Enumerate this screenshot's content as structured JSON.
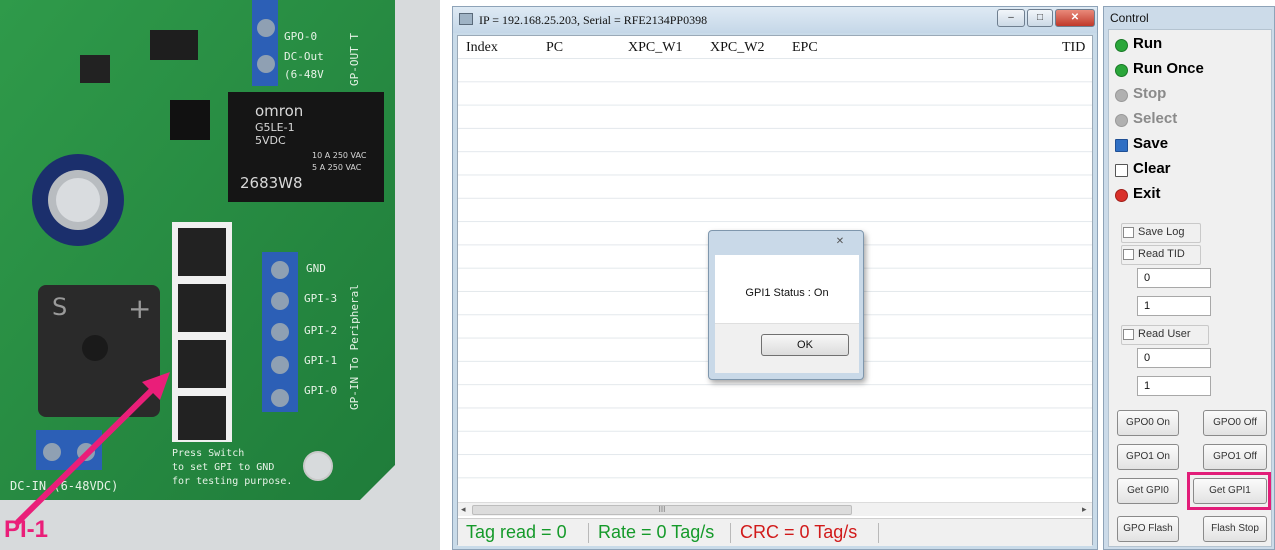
{
  "photo": {
    "board_relay_brand": "omron",
    "board_relay_model": "G5LE-1",
    "board_relay_voltage": "5VDC",
    "board_relay_code": "2683W8",
    "board_relay_rating1": "10 A 250 VAC",
    "board_relay_rating2": "5 A 250 VAC",
    "silk_gpo0": "GPO-0",
    "silk_dcout": "DC-Out",
    "silk_range_out": "(6-48V",
    "silk_gpout": "GP-OUT T",
    "silk_gnd": "GND",
    "silk_gpi3": "GPI-3",
    "silk_gpi2": "GPI-2",
    "silk_gpi1": "GPI-1",
    "silk_gpi0": "GPI-0",
    "silk_gpin": "GP-IN To Peripheral",
    "silk_press_line1": "Press Switch",
    "silk_press_line2": "to set GPI to GND",
    "silk_press_line3": "for testing purpose.",
    "silk_dcin": "DC-IN (6-48VDC)",
    "silk_s": "S",
    "silk_plus": "+",
    "callout_label": "PI-1"
  },
  "tag_window": {
    "title": "IP = 192.168.25.203, Serial = RFE2134PP0398",
    "minimize_glyph": "–",
    "maximize_glyph": "□",
    "close_glyph": "✕",
    "columns": [
      "Index",
      "PC",
      "XPC_W1",
      "XPC_W2",
      "EPC",
      "TID"
    ],
    "scroll_left_glyph": "◂",
    "scroll_right_glyph": "▸",
    "scroll_thumb_glyph": "III",
    "status": {
      "tag_read": "Tag read = 0",
      "rate": "Rate = 0 Tag/s",
      "crc": "CRC = 0 Tag/s"
    },
    "dialog": {
      "close_glyph": "✕",
      "message": "GPI1 Status : On",
      "ok_label": "OK"
    }
  },
  "control": {
    "title": "Control",
    "menu": [
      {
        "label": "Run",
        "color": "#1a1a1a",
        "icon_color": "#2aa63a"
      },
      {
        "label": "Run Once",
        "color": "#1a1a1a",
        "icon_color": "#2aa63a"
      },
      {
        "label": "Stop",
        "color": "#8a8a8a",
        "icon_color": "#b0b0b0"
      },
      {
        "label": "Select",
        "color": "#8a8a8a",
        "icon_color": "#b0b0b0"
      },
      {
        "label": "Save",
        "color": "#1a1a1a",
        "icon_color": "#2f6fc4"
      },
      {
        "label": "Clear",
        "color": "#1a1a1a",
        "icon_color": "#ffffff"
      },
      {
        "label": "Exit",
        "color": "#1a1a1a",
        "icon_color": "#d9302a"
      }
    ],
    "save_log_label": "Save Log",
    "read_tid_label": "Read TID",
    "tid_field1": "0",
    "tid_field2": "1",
    "read_user_label": "Read User",
    "user_field1": "0",
    "user_field2": "1",
    "buttons": {
      "gpo0_on": "GPO0 On",
      "gpo0_off": "GPO0 Off",
      "gpo1_on": "GPO1 On",
      "gpo1_off": "GPO1 Off",
      "get_gpi0": "Get GPI0",
      "get_gpi1": "Get GPI1",
      "gpo_flash": "GPO Flash",
      "flash_stop": "Flash Stop"
    }
  },
  "colors": {
    "accent_pink": "#e21d79",
    "status_green": "#159a2a",
    "status_red": "#d11a1a"
  }
}
